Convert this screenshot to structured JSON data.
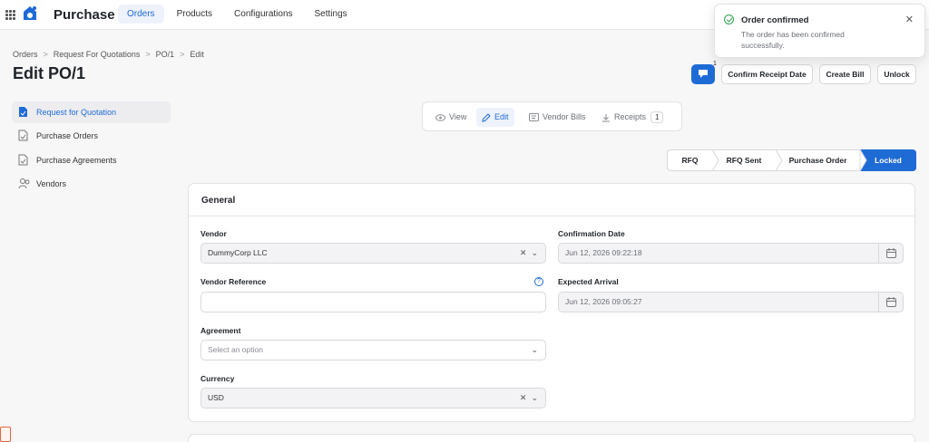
{
  "app": {
    "title": "Purchase"
  },
  "nav": [
    {
      "label": "Orders"
    },
    {
      "label": "Products"
    },
    {
      "label": "Configurations"
    },
    {
      "label": "Settings"
    }
  ],
  "toast": {
    "title": "Order confirmed",
    "message": "The order has been confirmed successfully.",
    "close": "✕"
  },
  "breadcrumb": [
    "Orders",
    "Request For Quotations",
    "PO/1",
    "Edit"
  ],
  "breadcrumb_sep": ">",
  "page": {
    "title": "Edit PO/1"
  },
  "actions": {
    "chat_badge": "1",
    "confirm_receipt": "Confirm Receipt Date",
    "create_bill": "Create Bill",
    "unlock": "Unlock"
  },
  "sidebar": [
    {
      "label": "Request for Quotation",
      "icon": "document-icon"
    },
    {
      "label": "Purchase Orders",
      "icon": "file-check-icon"
    },
    {
      "label": "Purchase Agreements",
      "icon": "file-check-icon"
    },
    {
      "label": "Vendors",
      "icon": "users-icon"
    }
  ],
  "view_tabs": {
    "view": "View",
    "edit": "Edit",
    "vendor_bills": "Vendor Bills",
    "receipts": "Receipts",
    "receipts_count": "1"
  },
  "stepper": [
    "RFQ",
    "RFQ Sent",
    "Purchase Order",
    "Locked"
  ],
  "general": {
    "title": "General",
    "vendor_label": "Vendor",
    "vendor_value": "DummyCorp LLC",
    "vendor_ref_label": "Vendor Reference",
    "vendor_ref_value": "",
    "agreement_label": "Agreement",
    "agreement_placeholder": "Select an option",
    "currency_label": "Currency",
    "currency_value": "USD",
    "confirmation_label": "Confirmation Date",
    "confirmation_value": "Jun 12, 2026 09:22:18",
    "arrival_label": "Expected Arrival",
    "arrival_value": "Jun 12, 2026 09:05:27",
    "help": "?"
  },
  "colors": {
    "accent": "#1f6bd6",
    "success": "#2ea44f"
  }
}
